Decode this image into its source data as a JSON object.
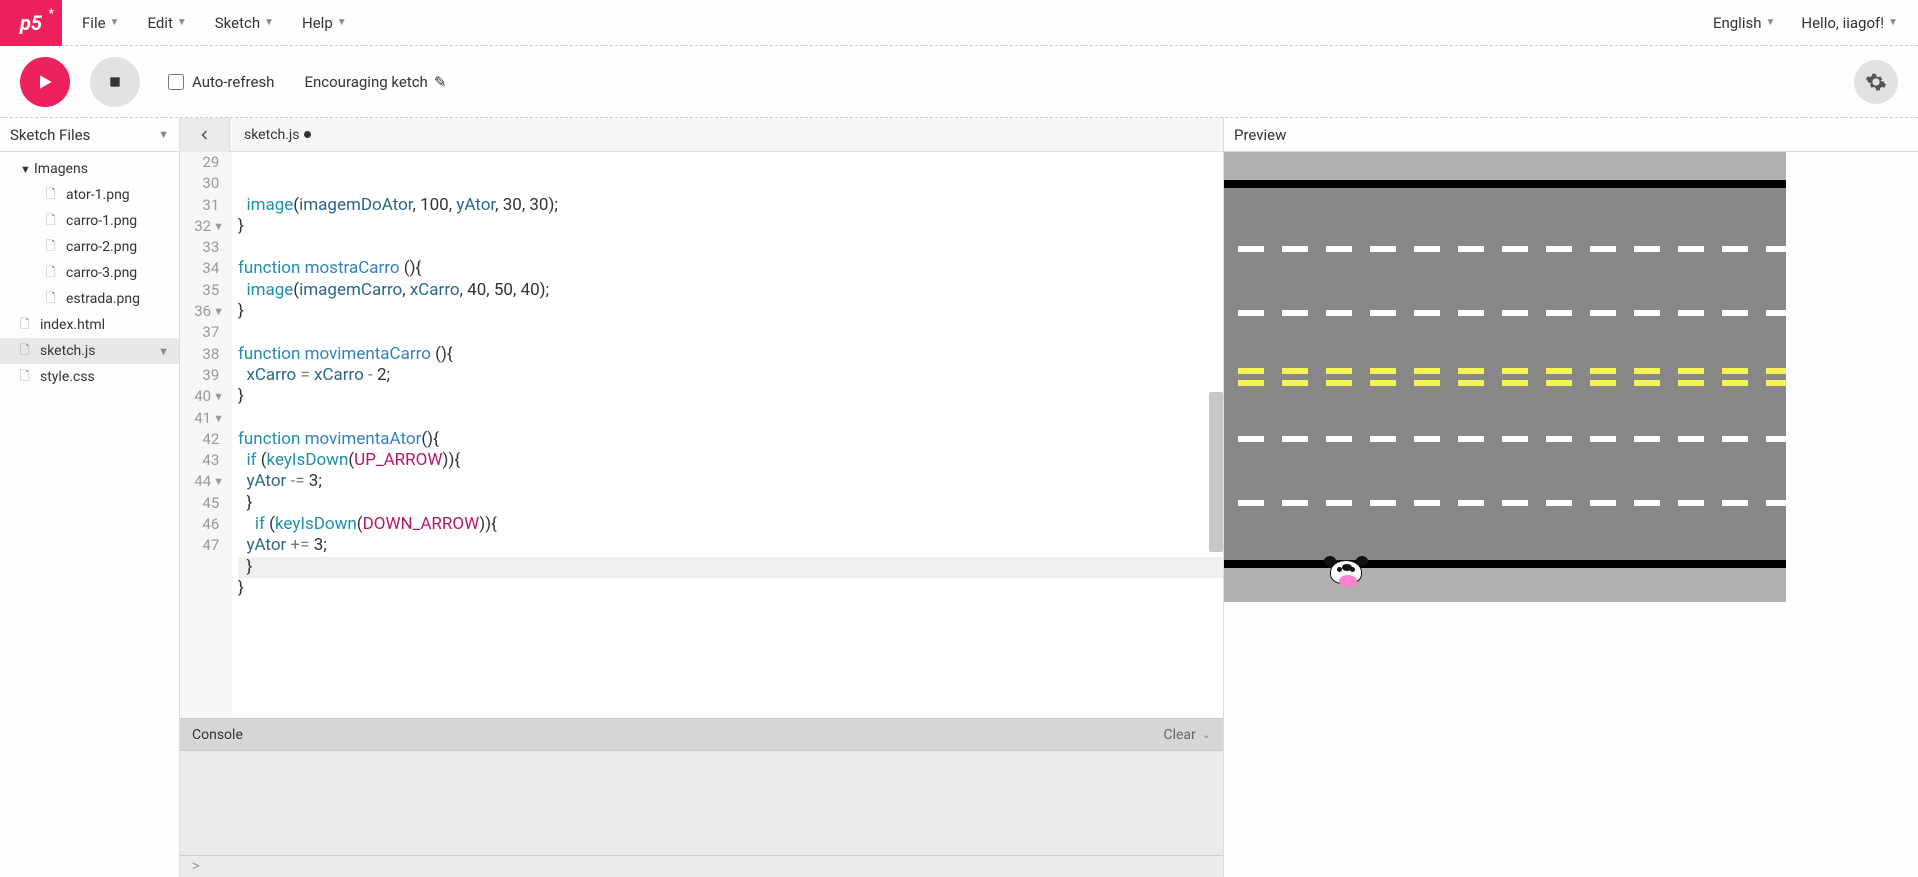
{
  "menubar": {
    "logo": "p5",
    "items": [
      "File",
      "Edit",
      "Sketch",
      "Help"
    ],
    "language": "English",
    "greeting": "Hello, iiagof!"
  },
  "toolbar": {
    "auto_refresh_label": "Auto-refresh",
    "sketch_name": "Encouraging ketch"
  },
  "sidebar": {
    "title": "Sketch Files",
    "folder": "Imagens",
    "folder_files": [
      "ator-1.png",
      "carro-1.png",
      "carro-2.png",
      "carro-3.png",
      "estrada.png"
    ],
    "root_files": [
      "index.html",
      "sketch.js",
      "style.css"
    ],
    "selected": "sketch.js"
  },
  "editor": {
    "tab_name": "sketch.js",
    "first_line_no": 29,
    "lines": [
      {
        "n": 29,
        "html": "  <span class='kw'>image</span><span class='punct'>(</span><span class='name'>imagemDoAtor</span><span class='punct'>, </span><span class='num'>100</span><span class='punct'>, </span><span class='name'>yAtor</span><span class='punct'>, </span><span class='num'>30</span><span class='punct'>, </span><span class='num'>30</span><span class='punct'>);</span>"
      },
      {
        "n": 30,
        "html": "<span class='punct'>}</span>"
      },
      {
        "n": 31,
        "html": ""
      },
      {
        "n": 32,
        "fold": true,
        "html": "<span class='kw'>function</span> <span class='fn'>mostraCarro</span> <span class='punct'>(){</span>"
      },
      {
        "n": 33,
        "html": "  <span class='kw'>image</span><span class='punct'>(</span><span class='name'>imagemCarro</span><span class='punct'>, </span><span class='name'>xCarro</span><span class='punct'>, </span><span class='num'>40</span><span class='punct'>, </span><span class='num'>50</span><span class='punct'>, </span><span class='num'>40</span><span class='punct'>);</span>"
      },
      {
        "n": 34,
        "html": "<span class='punct'>}</span>"
      },
      {
        "n": 35,
        "html": ""
      },
      {
        "n": 36,
        "fold": true,
        "html": "<span class='kw'>function</span> <span class='fn'>movimentaCarro</span> <span class='punct'>(){</span>"
      },
      {
        "n": 37,
        "html": "  <span class='name'>xCarro</span> <span class='op'>=</span> <span class='name'>xCarro</span> <span class='op'>-</span> <span class='num'>2</span><span class='punct'>;</span>"
      },
      {
        "n": 38,
        "html": "<span class='punct'>}</span>"
      },
      {
        "n": 39,
        "html": ""
      },
      {
        "n": 40,
        "fold": true,
        "html": "<span class='kw'>function</span> <span class='fn'>movimentaAtor</span><span class='punct'>(){</span>"
      },
      {
        "n": 41,
        "fold": true,
        "html": "  <span class='kw'>if</span> <span class='punct'>(</span><span class='kw'>keyIsDown</span><span class='punct'>(</span><span class='const'>UP_ARROW</span><span class='punct'>)){</span>"
      },
      {
        "n": 42,
        "html": "  <span class='name'>yAtor</span> <span class='op'>-=</span> <span class='num'>3</span><span class='punct'>;</span>"
      },
      {
        "n": 43,
        "html": "  <span class='punct'>}</span>"
      },
      {
        "n": 44,
        "fold": true,
        "html": "    <span class='kw'>if</span> <span class='punct'>(</span><span class='kw'>keyIsDown</span><span class='punct'>(</span><span class='const'>DOWN_ARROW</span><span class='punct'>)){</span>"
      },
      {
        "n": 45,
        "html": "  <span class='name'>yAtor</span> <span class='op'>+=</span> <span class='num'>3</span><span class='punct'>;</span>"
      },
      {
        "n": 46,
        "highlight": true,
        "html": "  <span class='punct'>}</span>"
      },
      {
        "n": 47,
        "html": "<span class='punct'>}</span>"
      }
    ]
  },
  "console": {
    "title": "Console",
    "clear": "Clear"
  },
  "preview": {
    "title": "Preview"
  }
}
